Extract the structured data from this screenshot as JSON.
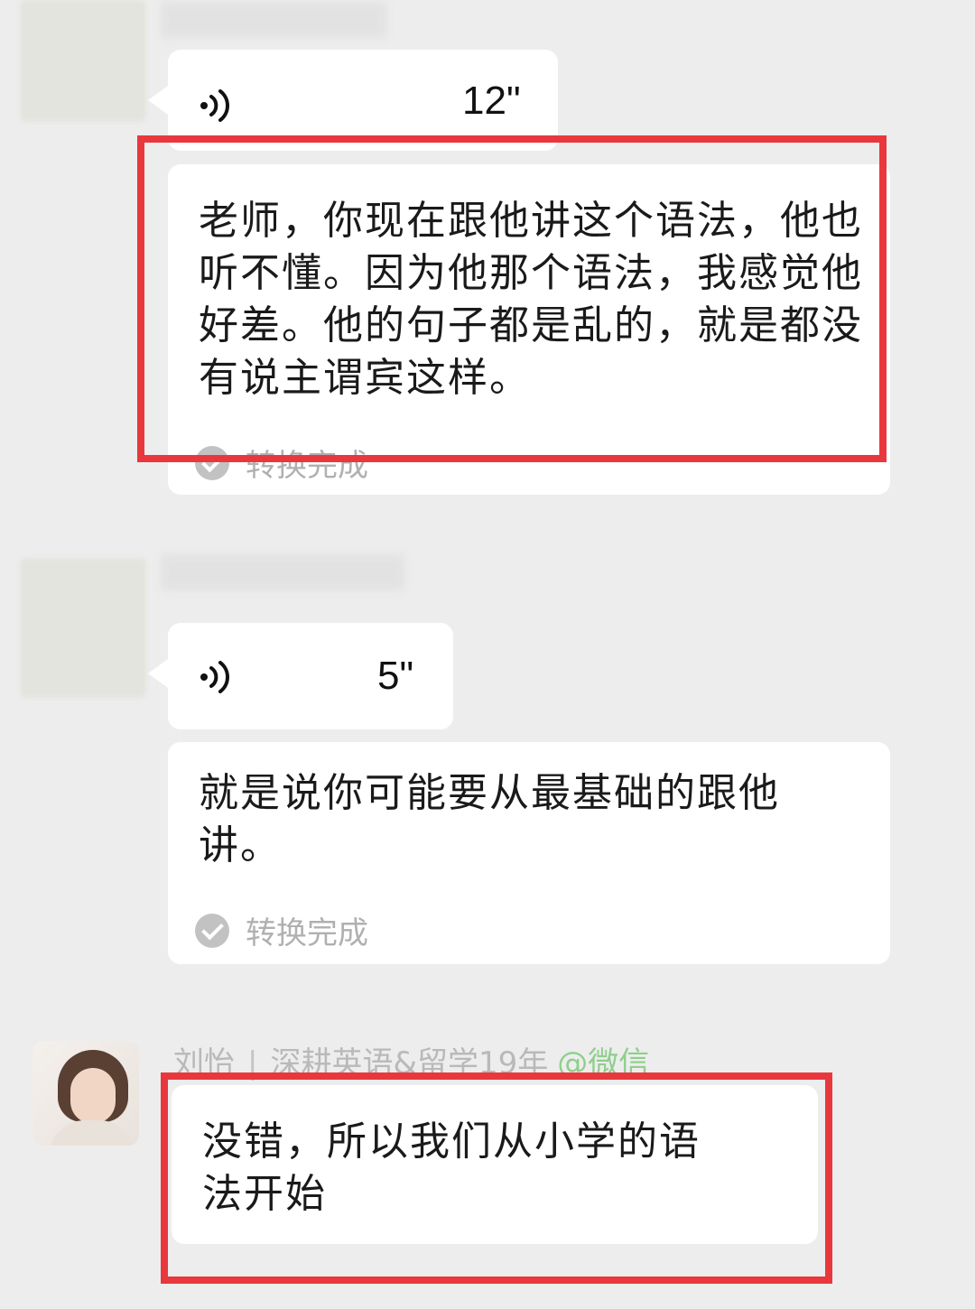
{
  "messages": [
    {
      "voice_duration": "12\"",
      "transcript": "老师，你现在跟他讲这个语法，他也听不懂。因为他那个语法，我感觉他好差。他的句子都是乱的，就是都没有说主谓宾这样。",
      "status": "转换完成"
    },
    {
      "voice_duration": "5\"",
      "transcript": "就是说你可能要从最基础的跟他讲。",
      "status": "转换完成"
    }
  ],
  "reply": {
    "sender_name": "刘怡",
    "sender_title": "深耕英语&留学19年",
    "sender_tag": "@微信",
    "text": "没错，所以我们从小学的语法开始"
  },
  "colors": {
    "background": "#ededed",
    "bubble": "#ffffff",
    "highlight": "#e8383d",
    "wechat_tag": "#8fcf8c"
  }
}
